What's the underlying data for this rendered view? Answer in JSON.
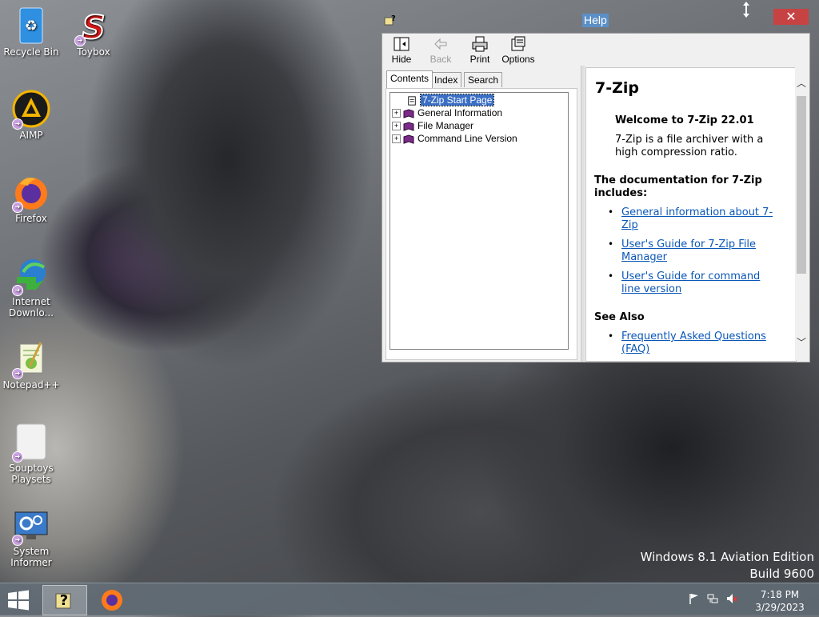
{
  "desktop": {
    "icons": [
      {
        "label": "Recycle Bin",
        "icon": "recycle-bin-icon"
      },
      {
        "label": "Toybox",
        "icon": "toybox-icon"
      },
      {
        "label": "AIMP",
        "icon": "aimp-icon"
      },
      {
        "label": "Firefox",
        "icon": "firefox-icon"
      },
      {
        "label": "Internet Downlo...",
        "icon": "internet-download-manager-icon"
      },
      {
        "label": "Notepad++",
        "icon": "notepad-plus-plus-icon"
      },
      {
        "label": "Souptoys Playsets",
        "icon": "souptoys-icon"
      },
      {
        "label": "System Informer",
        "icon": "system-informer-icon"
      }
    ]
  },
  "help_window": {
    "title": "Help",
    "close_glyph": "✕",
    "toolbar": {
      "hide": "Hide",
      "back": "Back",
      "print": "Print",
      "options": "Options"
    },
    "tabs": [
      "Contents",
      "Index",
      "Search"
    ],
    "tree": [
      {
        "label": "7-Zip Start Page",
        "selected": true
      },
      {
        "label": "General Information"
      },
      {
        "label": "File Manager"
      },
      {
        "label": "Command Line Version"
      }
    ],
    "content": {
      "title": "7-Zip",
      "welcome": "Welcome to 7-Zip 22.01",
      "description": "7-Zip is a file archiver with a high compression ratio.",
      "docs_heading": "The documentation for 7-Zip includes:",
      "links": [
        "General information about 7-Zip",
        "User's Guide for 7-Zip File Manager",
        "User's Guide for command line version"
      ],
      "see_also_heading": "See Also",
      "see_also_links": [
        "Frequently Asked Questions (FAQ)"
      ]
    }
  },
  "watermark": {
    "line1": "Windows 8.1 Aviation Edition",
    "line2": "Build 9600"
  },
  "taskbar": {
    "time": "7:18 PM",
    "date": "3/29/2023"
  },
  "colors": {
    "selection": "#3a6fc4",
    "link": "#0b57b8",
    "close": "#c74343"
  }
}
